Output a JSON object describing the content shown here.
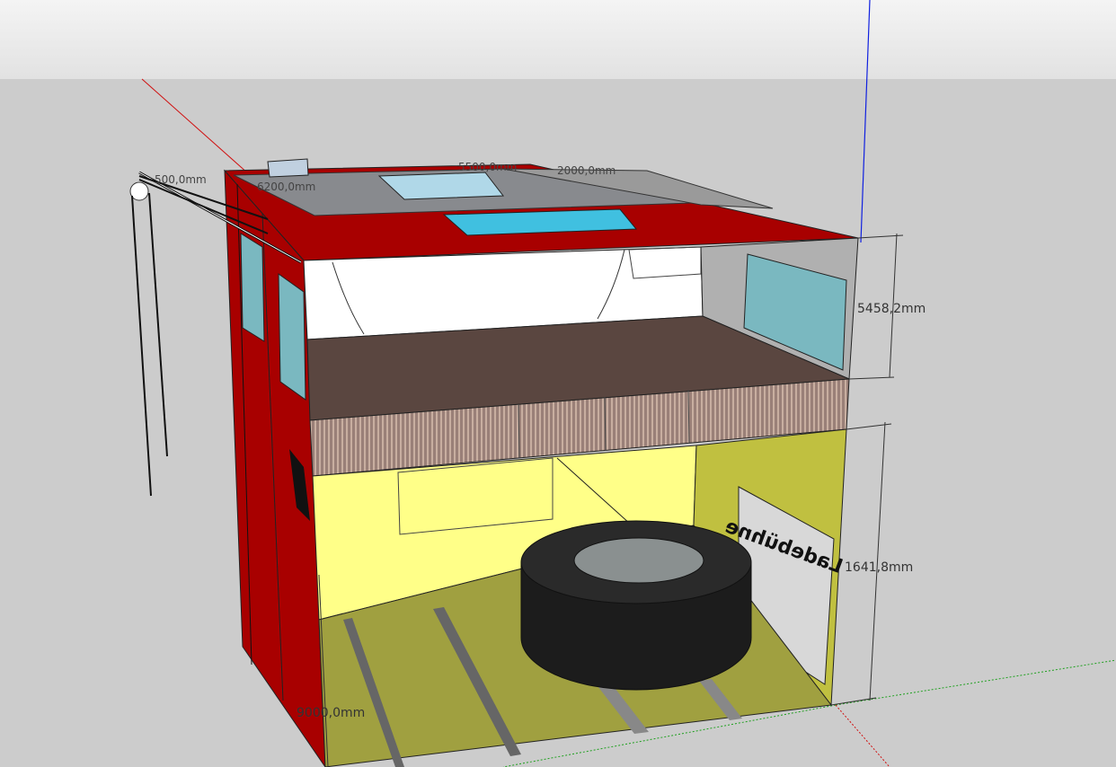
{
  "viewport": {
    "sky_color": "#f0f0f0",
    "ground_color": "#cccccc",
    "axis_colors": {
      "red": "#d01010",
      "green": "#20a020",
      "blue": "#1020e0"
    }
  },
  "model": {
    "colors": {
      "wall_red": "#a80000",
      "upper_interior": "#ffffff",
      "upper_right_wall": "#b0b0b0",
      "floor_brown": "#5a4640",
      "lower_interior_yellow": "#ffff88",
      "lower_right_wall": "#c0c040",
      "lower_floor": "#a0a040",
      "tire": "#202020",
      "tire_hub": "#8a9090",
      "window_glass": "#7ab8c0",
      "skylight": "#40c0e0"
    },
    "sign_text": "Ladebühne"
  },
  "dimensions": {
    "height_upper": "5458,2mm",
    "height_lower": "1641,8mm",
    "length_bottom": "9000,0mm",
    "top_a": "5500,0mm",
    "top_b": "2000,0mm",
    "top_left_a": "500,0mm",
    "top_left_b": "6200,0mm"
  }
}
